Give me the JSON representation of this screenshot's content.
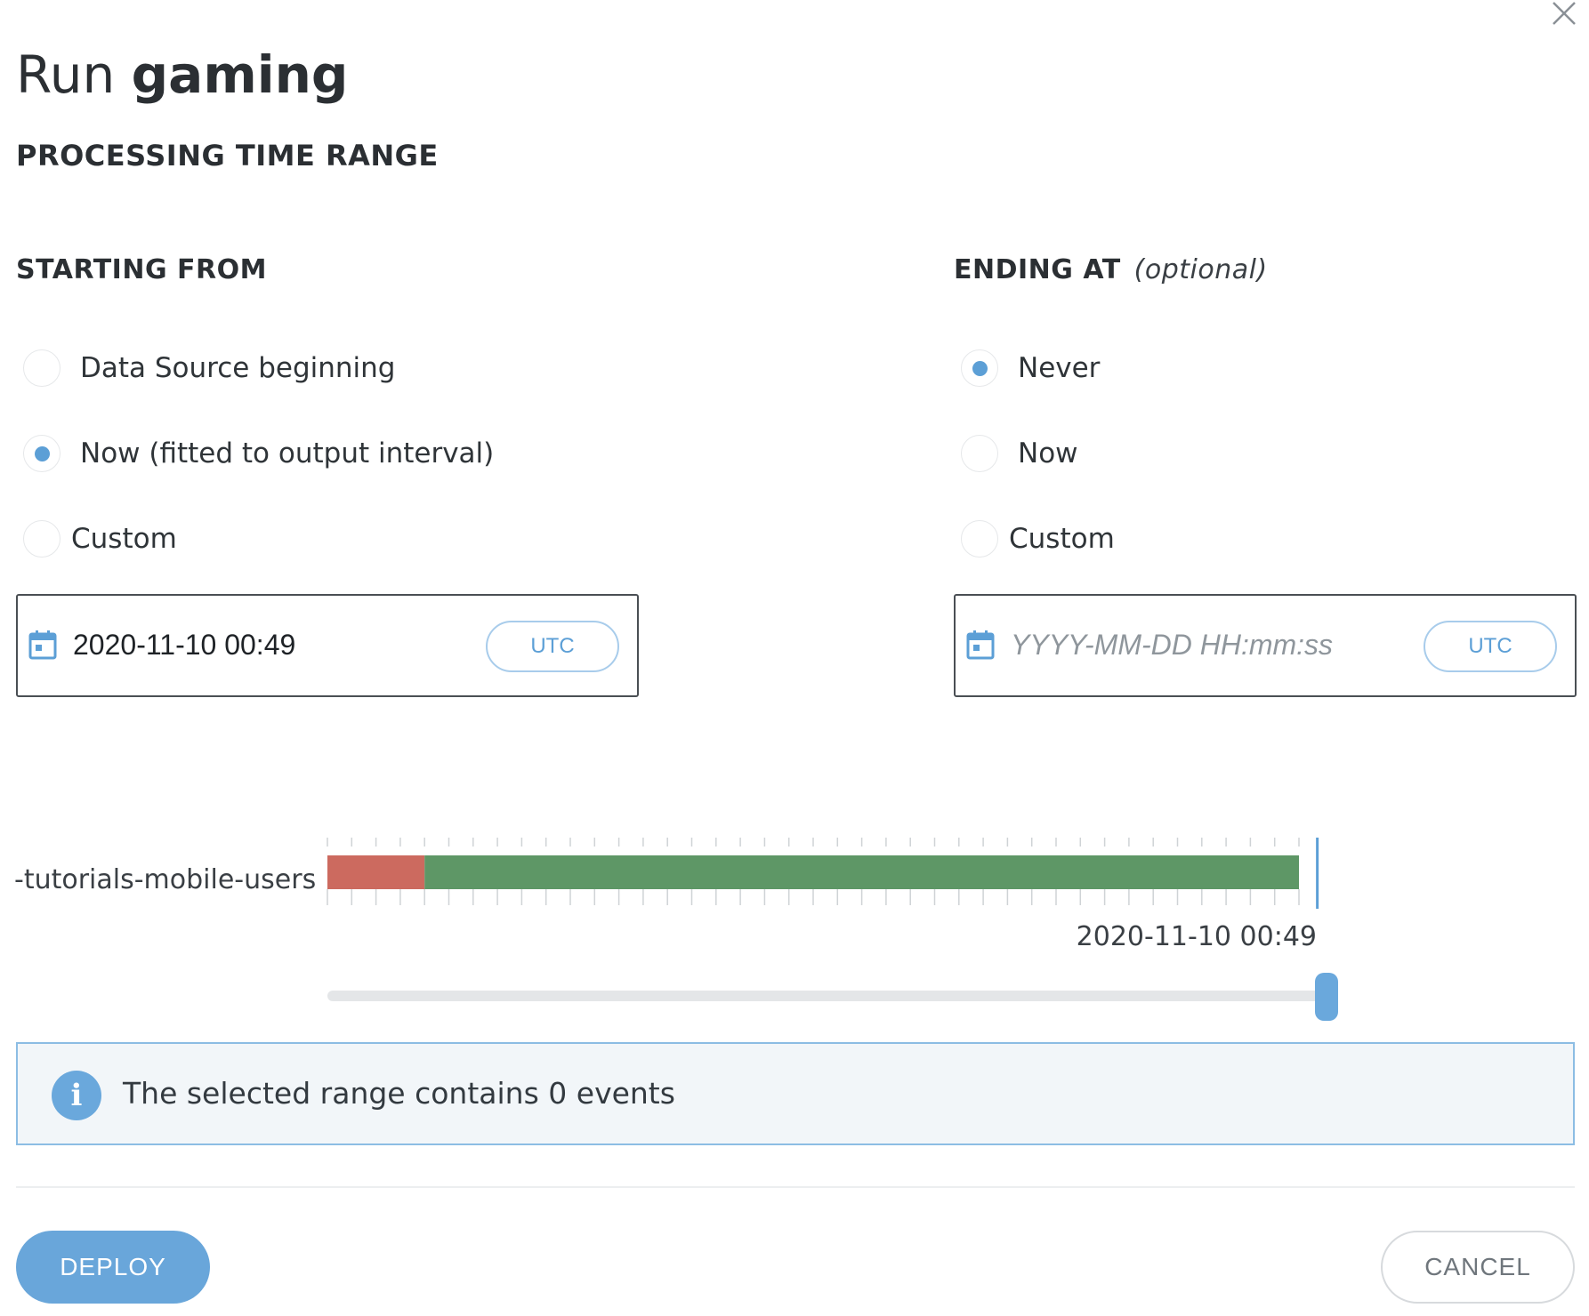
{
  "dialog": {
    "title_prefix": "Run",
    "title_name": "gaming",
    "section_heading": "PROCESSING TIME RANGE"
  },
  "starting_from": {
    "heading": "STARTING FROM",
    "options": [
      {
        "label": "Data Source beginning",
        "checked": false
      },
      {
        "label": "Now (fitted to output interval)",
        "checked": true
      },
      {
        "label": "Custom",
        "checked": false
      }
    ],
    "date_value": "2020-11-10 00:49",
    "date_placeholder": "YYYY-MM-DD HH:mm:ss",
    "timezone_label": "UTC"
  },
  "ending_at": {
    "heading": "ENDING AT",
    "heading_note": "(optional)",
    "options": [
      {
        "label": "Never",
        "checked": true
      },
      {
        "label": "Now",
        "checked": false
      },
      {
        "label": "Custom",
        "checked": false
      }
    ],
    "date_value": "",
    "date_placeholder": "YYYY-MM-DD HH:mm:ss",
    "timezone_label": "UTC"
  },
  "timeline": {
    "source_label": "-tutorials-mobile-users",
    "marker_date": "2020-11-10 00:49",
    "tick_count": 40,
    "segments": [
      {
        "status": "missing",
        "color": "#cc6a5f",
        "fraction": 0.1
      },
      {
        "status": "available",
        "color": "#5e9766",
        "fraction": 0.9
      }
    ],
    "bar_coverage": 0.975,
    "slider_position": 0.997,
    "marker_color": "#5c9fd6"
  },
  "info": {
    "icon": "info-icon",
    "message": "The selected range contains 0 events"
  },
  "footer": {
    "deploy_label": "DEPLOY",
    "cancel_label": "CANCEL"
  },
  "colors": {
    "accent": "#69a6da",
    "info_border": "#8cbde4",
    "info_bg": "#f2f6f9"
  }
}
